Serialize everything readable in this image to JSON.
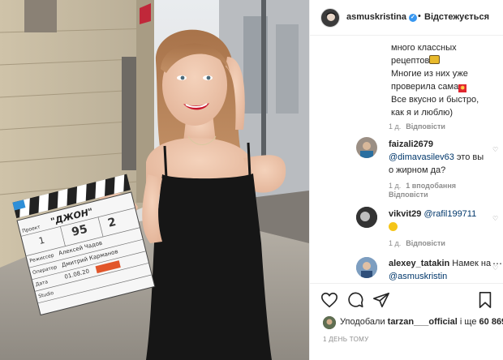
{
  "post": {
    "username": "asmuskristina",
    "dot": "•",
    "follow_label": "Відстежується",
    "more_icon": "⋯"
  },
  "caption": {
    "line1": "много классных",
    "line2": "рецептов",
    "line3": "Многие из них уже",
    "line4": "проверила сама",
    "line5": "Все вкусно и быстро,",
    "line6": "как я и люблю)",
    "age": "1 д.",
    "replies_label": "Відповісти"
  },
  "comments": [
    {
      "username": "faizali2679",
      "mention": "@dimavasilev63",
      "text": " это вы",
      "text2": "о жирном да?",
      "age": "1 д.",
      "likes_label": "1 вподобання",
      "reply_label": "Відповісти"
    },
    {
      "username": "vikvit29",
      "mention": "@rafil199711",
      "age": "1 д.",
      "reply_label": "Відповісти"
    },
    {
      "username": "alexey_tatakin",
      "text": " Намек на",
      "mention": "@asmuskristin"
    }
  ],
  "likes": {
    "prefix": "Уподобали ",
    "user": "tarzan___official",
    "middle": " і ще ",
    "count": "60 869"
  },
  "timestamp": "1 ДЕНЬ ТОМУ",
  "clapper": {
    "title": "\"ДЖОН\"",
    "scene": "95",
    "take": "2",
    "num": "1",
    "row_project": "Проект",
    "row_director": "Режиссер",
    "director": "Алексей Чадов",
    "row_operator": "Оператор",
    "operator": "Дмитрий Карманов",
    "row_date": "Дата",
    "date": "01.08.20",
    "studio": "Studio"
  },
  "colors": {
    "accent": "#3897f0",
    "mention": "#00376b",
    "muted": "#8e8e8e",
    "lipstick": "#c9142b"
  }
}
